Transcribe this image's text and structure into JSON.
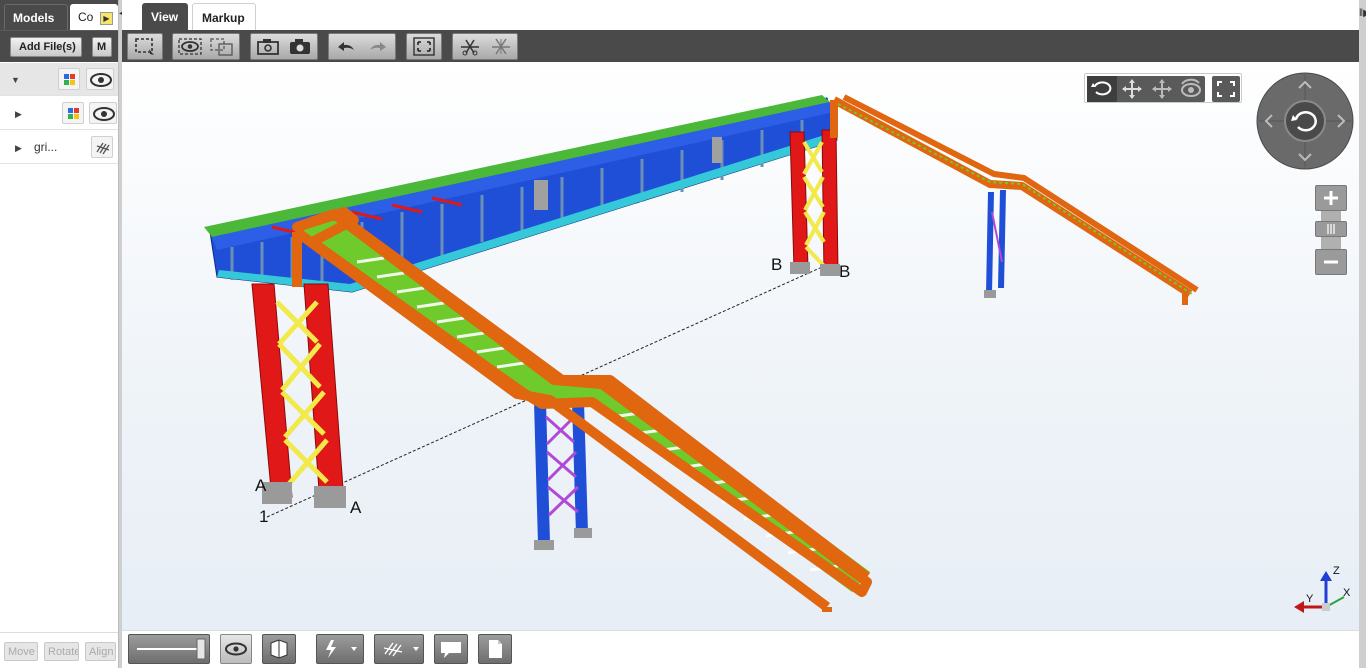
{
  "left_panel": {
    "tabs": [
      {
        "label": "Models"
      },
      {
        "label": "Co"
      }
    ],
    "add_files_label": "Add File(s)",
    "second_button_label": "M",
    "tree": [
      {
        "label": ""
      },
      {
        "label": ""
      },
      {
        "label": "gri..."
      }
    ],
    "bottom_buttons": [
      {
        "label": "Move"
      },
      {
        "label": "Rotate"
      },
      {
        "label": "Align"
      }
    ]
  },
  "main_tabs": [
    {
      "label": "View"
    },
    {
      "label": "Markup"
    }
  ],
  "toolbar_icons": [
    "select-box-icon",
    "hide-icon",
    "show-hidden-icon",
    "snapshot-icon",
    "camera-icon",
    "undo-icon",
    "redo-icon",
    "fit-view-icon",
    "cut-plane-icon",
    "clear-cut-icon"
  ],
  "nav_icons": [
    "orbit-icon",
    "pan-icon",
    "pan-alt-icon",
    "walk-icon",
    "fullscreen-icon"
  ],
  "model_labels": {
    "a_left": "A",
    "a_right": "A",
    "b_left": "B",
    "b_right": "B",
    "grid_1": "1"
  },
  "axis_labels": {
    "z": "Z",
    "y": "Y",
    "x": "X"
  },
  "colors": {
    "beam_blue": "#1f4fd6",
    "column_red": "#e01818",
    "brace_yellow": "#f2e94a",
    "stair_orange": "#e0660f",
    "tread_green": "#6fcb2c",
    "brace_purple": "#b04ad6",
    "toolbar_dark": "#4a4a4a"
  }
}
